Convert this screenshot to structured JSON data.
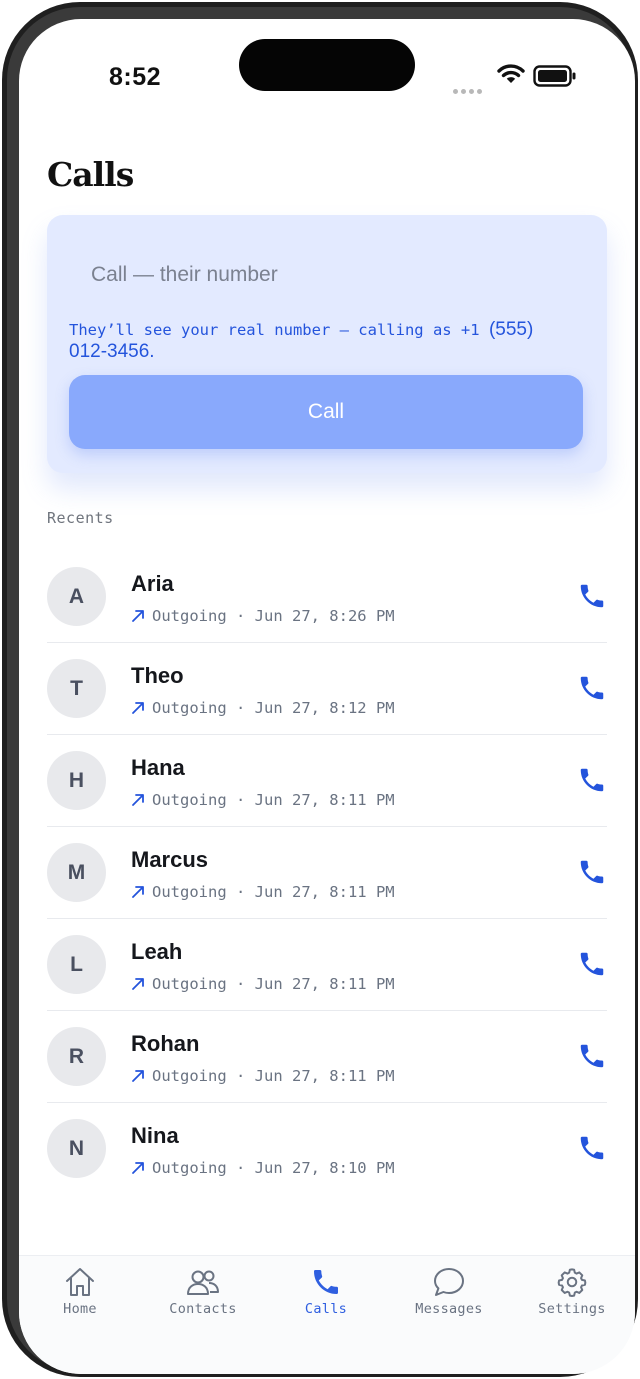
{
  "status_bar": {
    "time": "8:52",
    "icons": [
      "signal-dots-icon",
      "wifi-icon",
      "battery-icon"
    ]
  },
  "page": {
    "title": "Calls"
  },
  "dialer": {
    "input_placeholder": "Call — their number",
    "input_value": "",
    "note_text": "They’ll see your real number — calling as +1",
    "note_number": "(555) 012-3456.",
    "call_button_label": "Call"
  },
  "recents": {
    "label": "Recents",
    "items": [
      {
        "initial": "A",
        "name": "Aria",
        "direction": "Outgoing",
        "datetime": "Jun 27, 8:26 PM"
      },
      {
        "initial": "T",
        "name": "Theo",
        "direction": "Outgoing",
        "datetime": "Jun 27, 8:12 PM"
      },
      {
        "initial": "H",
        "name": "Hana",
        "direction": "Outgoing",
        "datetime": "Jun 27, 8:11 PM"
      },
      {
        "initial": "M",
        "name": "Marcus",
        "direction": "Outgoing",
        "datetime": "Jun 27, 8:11 PM"
      },
      {
        "initial": "L",
        "name": "Leah",
        "direction": "Outgoing",
        "datetime": "Jun 27, 8:11 PM"
      },
      {
        "initial": "R",
        "name": "Rohan",
        "direction": "Outgoing",
        "datetime": "Jun 27, 8:11 PM"
      },
      {
        "initial": "N",
        "name": "Nina",
        "direction": "Outgoing",
        "datetime": "Jun 27, 8:10 PM"
      }
    ]
  },
  "tab_bar": {
    "active": "Calls",
    "tabs": [
      {
        "label": "Home",
        "icon": "home-icon"
      },
      {
        "label": "Contacts",
        "icon": "contacts-icon"
      },
      {
        "label": "Calls",
        "icon": "phone-icon"
      },
      {
        "label": "Messages",
        "icon": "message-icon"
      },
      {
        "label": "Settings",
        "icon": "gear-icon"
      }
    ]
  },
  "colors": {
    "accent": "#2454dc",
    "card_background": "#e3eaff",
    "call_button": "#89a9fc",
    "avatar_background": "#e8e9ec",
    "text_primary": "#15171c",
    "text_muted": "#6a7382"
  }
}
